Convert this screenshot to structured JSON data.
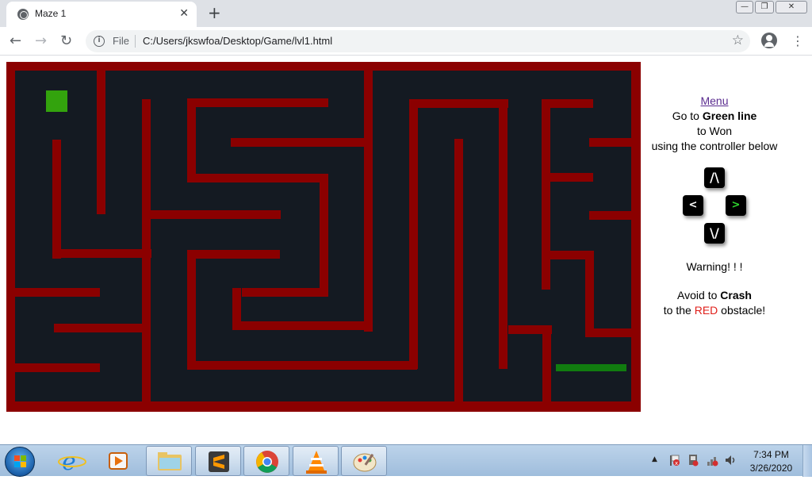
{
  "browser": {
    "tab_title": "Maze 1",
    "tab_close": "✕",
    "new_tab": "+",
    "scheme_label": "File",
    "url": "C:/Users/jkswfoa/Desktop/Game/lvl1.html",
    "window_buttons": [
      "—",
      "❐",
      "✕"
    ]
  },
  "game": {
    "background_color": "#141a22",
    "wall_color": "#8b0000",
    "player_color": "#33a30d",
    "goal_color": "#117c0f"
  },
  "panel": {
    "menu_link": "Menu",
    "line1_prefix": "Go to ",
    "line1_bold": "Green line",
    "line2": "to Won",
    "line3": "using the controller below",
    "warning": "Warning! ! !",
    "avoid_prefix": "Avoid to ",
    "avoid_bold": "Crash",
    "obstacle_prefix": "to the ",
    "obstacle_red": "RED",
    "obstacle_suffix": " obstacle!"
  },
  "controls": {
    "up": "/\\",
    "left": "<",
    "right": ">",
    "down": "\\/"
  },
  "taskbar": {
    "time": "7:34 PM",
    "date": "3/26/2020"
  }
}
